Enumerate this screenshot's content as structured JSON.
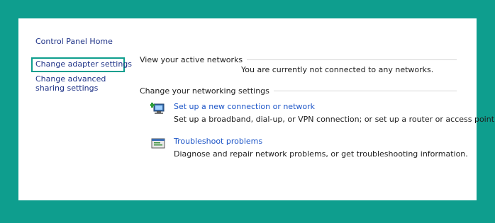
{
  "sidebar": {
    "home_label": "Control Panel Home",
    "adapter_label": "Change adapter settings",
    "advanced_label": "Change advanced sharing settings"
  },
  "active_networks": {
    "heading": "View your active networks",
    "status": "You are currently not connected to any networks."
  },
  "networking_settings": {
    "heading": "Change your networking settings",
    "items": [
      {
        "title": "Set up a new connection or network",
        "description": "Set up a broadband, dial-up, or VPN connection; or set up a router or access point.",
        "icon": "new-connection-icon"
      },
      {
        "title": "Troubleshoot problems",
        "description": "Diagnose and repair network problems, or get troubleshooting information.",
        "icon": "troubleshoot-icon"
      }
    ]
  },
  "colors": {
    "frame": "#0e9e8e",
    "link": "#1e56c8",
    "nav_link": "#1e3287",
    "highlight_border": "#0e9e8e"
  }
}
